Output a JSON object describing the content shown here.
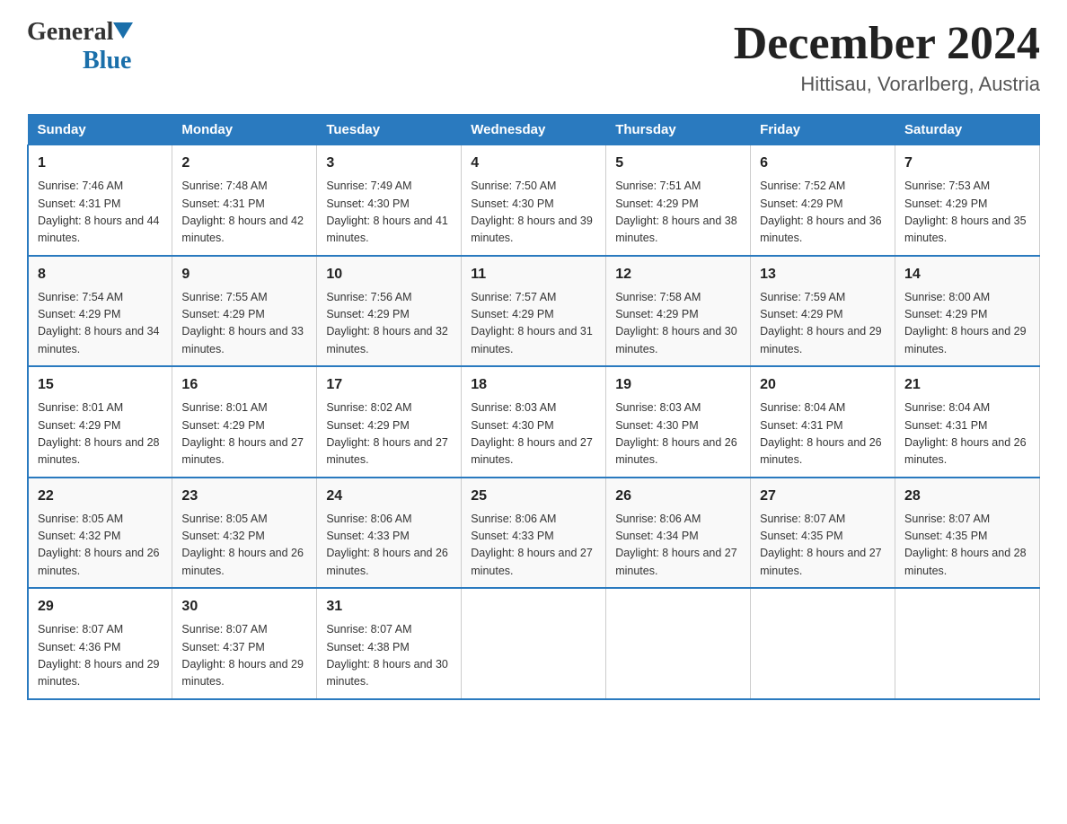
{
  "logo": {
    "general": "General",
    "blue": "Blue"
  },
  "title": {
    "month": "December 2024",
    "location": "Hittisau, Vorarlberg, Austria"
  },
  "headers": [
    "Sunday",
    "Monday",
    "Tuesday",
    "Wednesday",
    "Thursday",
    "Friday",
    "Saturday"
  ],
  "weeks": [
    [
      {
        "day": "1",
        "sunrise": "7:46 AM",
        "sunset": "4:31 PM",
        "daylight": "8 hours and 44 minutes."
      },
      {
        "day": "2",
        "sunrise": "7:48 AM",
        "sunset": "4:31 PM",
        "daylight": "8 hours and 42 minutes."
      },
      {
        "day": "3",
        "sunrise": "7:49 AM",
        "sunset": "4:30 PM",
        "daylight": "8 hours and 41 minutes."
      },
      {
        "day": "4",
        "sunrise": "7:50 AM",
        "sunset": "4:30 PM",
        "daylight": "8 hours and 39 minutes."
      },
      {
        "day": "5",
        "sunrise": "7:51 AM",
        "sunset": "4:29 PM",
        "daylight": "8 hours and 38 minutes."
      },
      {
        "day": "6",
        "sunrise": "7:52 AM",
        "sunset": "4:29 PM",
        "daylight": "8 hours and 36 minutes."
      },
      {
        "day": "7",
        "sunrise": "7:53 AM",
        "sunset": "4:29 PM",
        "daylight": "8 hours and 35 minutes."
      }
    ],
    [
      {
        "day": "8",
        "sunrise": "7:54 AM",
        "sunset": "4:29 PM",
        "daylight": "8 hours and 34 minutes."
      },
      {
        "day": "9",
        "sunrise": "7:55 AM",
        "sunset": "4:29 PM",
        "daylight": "8 hours and 33 minutes."
      },
      {
        "day": "10",
        "sunrise": "7:56 AM",
        "sunset": "4:29 PM",
        "daylight": "8 hours and 32 minutes."
      },
      {
        "day": "11",
        "sunrise": "7:57 AM",
        "sunset": "4:29 PM",
        "daylight": "8 hours and 31 minutes."
      },
      {
        "day": "12",
        "sunrise": "7:58 AM",
        "sunset": "4:29 PM",
        "daylight": "8 hours and 30 minutes."
      },
      {
        "day": "13",
        "sunrise": "7:59 AM",
        "sunset": "4:29 PM",
        "daylight": "8 hours and 29 minutes."
      },
      {
        "day": "14",
        "sunrise": "8:00 AM",
        "sunset": "4:29 PM",
        "daylight": "8 hours and 29 minutes."
      }
    ],
    [
      {
        "day": "15",
        "sunrise": "8:01 AM",
        "sunset": "4:29 PM",
        "daylight": "8 hours and 28 minutes."
      },
      {
        "day": "16",
        "sunrise": "8:01 AM",
        "sunset": "4:29 PM",
        "daylight": "8 hours and 27 minutes."
      },
      {
        "day": "17",
        "sunrise": "8:02 AM",
        "sunset": "4:29 PM",
        "daylight": "8 hours and 27 minutes."
      },
      {
        "day": "18",
        "sunrise": "8:03 AM",
        "sunset": "4:30 PM",
        "daylight": "8 hours and 27 minutes."
      },
      {
        "day": "19",
        "sunrise": "8:03 AM",
        "sunset": "4:30 PM",
        "daylight": "8 hours and 26 minutes."
      },
      {
        "day": "20",
        "sunrise": "8:04 AM",
        "sunset": "4:31 PM",
        "daylight": "8 hours and 26 minutes."
      },
      {
        "day": "21",
        "sunrise": "8:04 AM",
        "sunset": "4:31 PM",
        "daylight": "8 hours and 26 minutes."
      }
    ],
    [
      {
        "day": "22",
        "sunrise": "8:05 AM",
        "sunset": "4:32 PM",
        "daylight": "8 hours and 26 minutes."
      },
      {
        "day": "23",
        "sunrise": "8:05 AM",
        "sunset": "4:32 PM",
        "daylight": "8 hours and 26 minutes."
      },
      {
        "day": "24",
        "sunrise": "8:06 AM",
        "sunset": "4:33 PM",
        "daylight": "8 hours and 26 minutes."
      },
      {
        "day": "25",
        "sunrise": "8:06 AM",
        "sunset": "4:33 PM",
        "daylight": "8 hours and 27 minutes."
      },
      {
        "day": "26",
        "sunrise": "8:06 AM",
        "sunset": "4:34 PM",
        "daylight": "8 hours and 27 minutes."
      },
      {
        "day": "27",
        "sunrise": "8:07 AM",
        "sunset": "4:35 PM",
        "daylight": "8 hours and 27 minutes."
      },
      {
        "day": "28",
        "sunrise": "8:07 AM",
        "sunset": "4:35 PM",
        "daylight": "8 hours and 28 minutes."
      }
    ],
    [
      {
        "day": "29",
        "sunrise": "8:07 AM",
        "sunset": "4:36 PM",
        "daylight": "8 hours and 29 minutes."
      },
      {
        "day": "30",
        "sunrise": "8:07 AM",
        "sunset": "4:37 PM",
        "daylight": "8 hours and 29 minutes."
      },
      {
        "day": "31",
        "sunrise": "8:07 AM",
        "sunset": "4:38 PM",
        "daylight": "8 hours and 30 minutes."
      },
      null,
      null,
      null,
      null
    ]
  ]
}
